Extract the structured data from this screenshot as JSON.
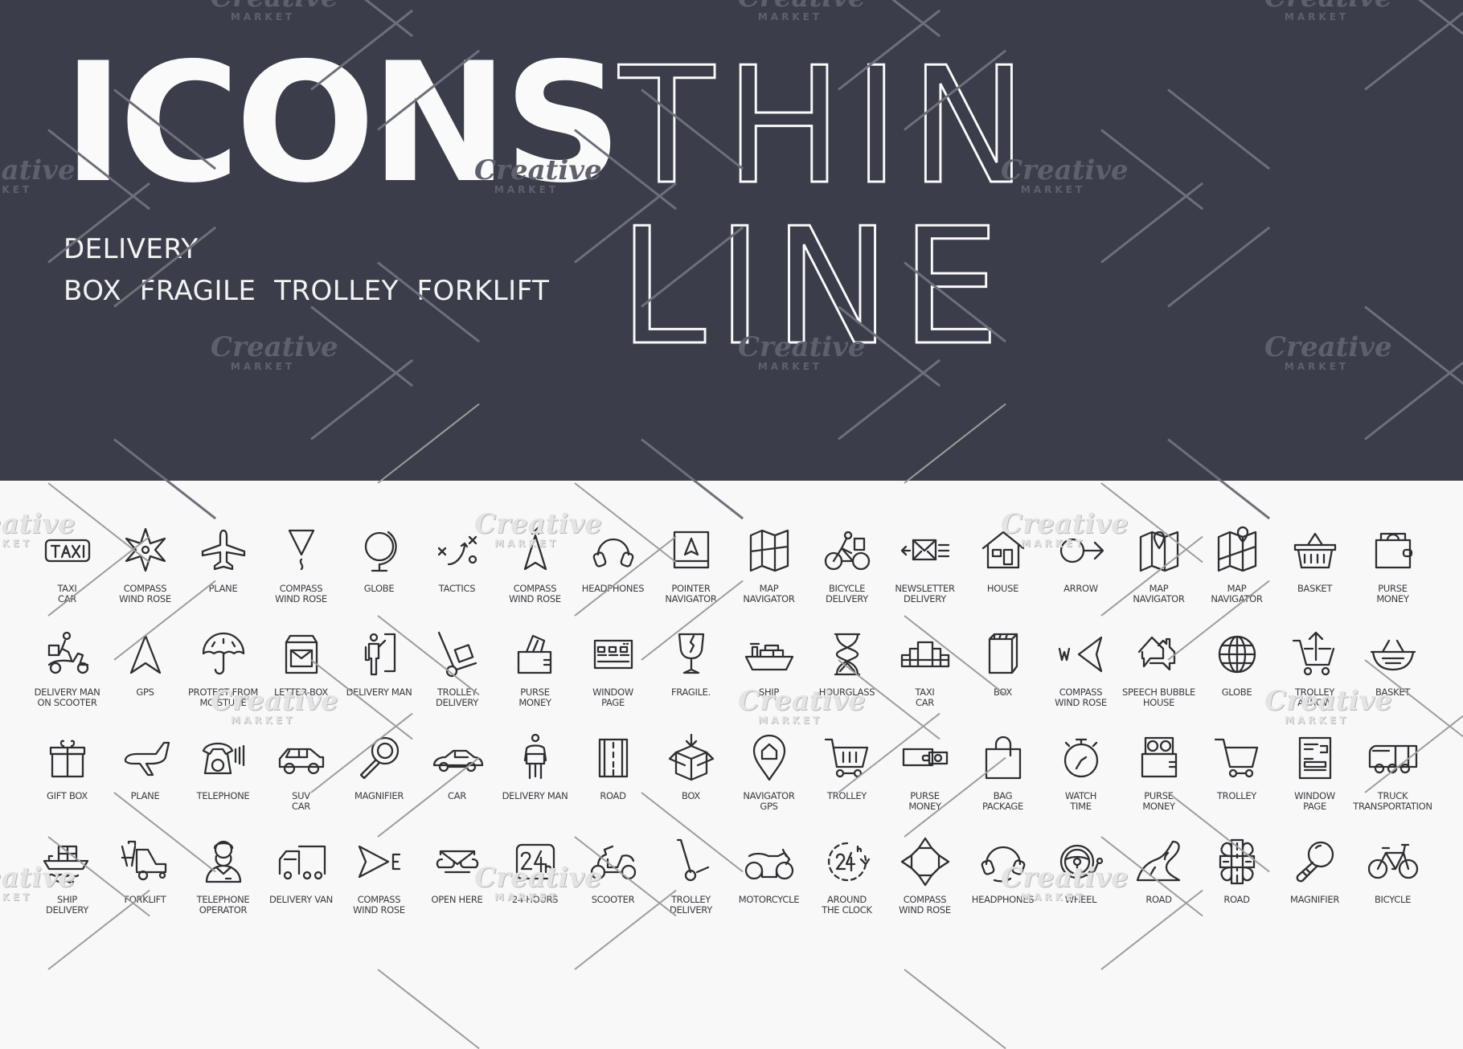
{
  "hero": {
    "title_bold": "ICONS",
    "title_thin": "THIN LINE",
    "category": "DELIVERY",
    "keywords": "BOX  FRAGILE  TROLLEY  FORKLIFT",
    "background_color": "#3b3e4a",
    "text_color": "#fafafa"
  },
  "watermark": {
    "line1": "Creative",
    "line2": "MARKET"
  },
  "icon_rows": [
    [
      {
        "icon": "taxi-sign-icon",
        "label": "TAXI\nCAR"
      },
      {
        "icon": "compass-star-icon",
        "label": "COMPASS\nWIND ROSE"
      },
      {
        "icon": "plane-icon",
        "label": "PLANE"
      },
      {
        "icon": "compass-south-icon",
        "label": "COMPASS\nWIND ROSE"
      },
      {
        "icon": "globe-stand-icon",
        "label": "GLOBE"
      },
      {
        "icon": "tactics-icon",
        "label": "TACTICS"
      },
      {
        "icon": "compass-north-icon",
        "label": "COMPASS\nWIND ROSE"
      },
      {
        "icon": "headphones-icon",
        "label": "HEADPHONES"
      },
      {
        "icon": "pointer-navigator-icon",
        "label": "POINTER\nNAVIGATOR"
      },
      {
        "icon": "folded-map-icon",
        "label": "MAP\nNAVIGATOR"
      },
      {
        "icon": "bicycle-delivery-icon",
        "label": "BICYCLE\nDELIVERY"
      },
      {
        "icon": "newsletter-icon",
        "label": "NEWSLETTER\nDELIVERY"
      },
      {
        "icon": "house-icon",
        "label": "HOUSE"
      },
      {
        "icon": "arrow-circle-icon",
        "label": "ARROW"
      },
      {
        "icon": "map-pin-icon",
        "label": "MAP\nNAVIGATOR"
      },
      {
        "icon": "map-pin-route-icon",
        "label": "MAP\nNAVIGATOR"
      },
      {
        "icon": "basket-icon",
        "label": "BASKET"
      },
      {
        "icon": "purse-icon",
        "label": "PURSE\nMONEY"
      }
    ],
    [
      {
        "icon": "delivery-scooter-icon",
        "label": "DELIVERY MAN\nON SCOOTER"
      },
      {
        "icon": "gps-arrow-icon",
        "label": "GPS"
      },
      {
        "icon": "umbrella-icon",
        "label": "PROTECT FROM\nMOISTURE"
      },
      {
        "icon": "letter-box-icon",
        "label": "LETTER-BOX"
      },
      {
        "icon": "delivery-man-door-icon",
        "label": "DELIVERY MAN"
      },
      {
        "icon": "hand-trolley-box-icon",
        "label": "TROLLEY\nDELIVERY"
      },
      {
        "icon": "purse-money-icon",
        "label": "PURSE\nMONEY"
      },
      {
        "icon": "window-page-icon",
        "label": "WINDOW\nPAGE"
      },
      {
        "icon": "broken-glass-icon",
        "label": "FRAGILE."
      },
      {
        "icon": "cargo-ship-icon",
        "label": "SHIP"
      },
      {
        "icon": "hourglass-icon",
        "label": "HOURGLASS"
      },
      {
        "icon": "taxi-checker-icon",
        "label": "TAXI\nCAR"
      },
      {
        "icon": "box-icon",
        "label": "BOX"
      },
      {
        "icon": "compass-west-icon",
        "label": "COMPASS\nWIND ROSE"
      },
      {
        "icon": "speech-bubble-house-icon",
        "label": "SPEECH BUBBLE\nHOUSE"
      },
      {
        "icon": "globe-icon",
        "label": "GLOBE"
      },
      {
        "icon": "trolley-arrow-icon",
        "label": "TROLLEY\nARROW"
      },
      {
        "icon": "basket-round-icon",
        "label": "BASKET"
      }
    ],
    [
      {
        "icon": "gift-box-icon",
        "label": "GIFT BOX"
      },
      {
        "icon": "plane-side-icon",
        "label": "PLANE"
      },
      {
        "icon": "telephone-icon",
        "label": "TELEPHONE"
      },
      {
        "icon": "suv-car-icon",
        "label": "SUV\nCAR"
      },
      {
        "icon": "magnifier-icon",
        "label": "MAGNIFIER"
      },
      {
        "icon": "sedan-car-icon",
        "label": "CAR"
      },
      {
        "icon": "delivery-man-box-icon",
        "label": "DELIVERY MAN"
      },
      {
        "icon": "road-straight-icon",
        "label": "ROAD"
      },
      {
        "icon": "open-box-icon",
        "label": "BOX"
      },
      {
        "icon": "navigator-pin-icon",
        "label": "NAVIGATOR\nGPS"
      },
      {
        "icon": "shopping-trolley-icon",
        "label": "TROLLEY"
      },
      {
        "icon": "purse-cash-icon",
        "label": "PURSE\nMONEY"
      },
      {
        "icon": "shopping-bag-icon",
        "label": "BAG\nPACKAGE"
      },
      {
        "icon": "stopwatch-icon",
        "label": "WATCH\nTIME"
      },
      {
        "icon": "wallet-coins-icon",
        "label": "PURSE\nMONEY"
      },
      {
        "icon": "cart-icon",
        "label": "TROLLEY"
      },
      {
        "icon": "document-page-icon",
        "label": "WINDOW\nPAGE"
      },
      {
        "icon": "truck-icon",
        "label": "TRUCK\nTRANSPORTATION"
      }
    ],
    [
      {
        "icon": "ship-delivery-icon",
        "label": "SHIP\nDELIVERY"
      },
      {
        "icon": "forklift-icon",
        "label": "FORKLIFT"
      },
      {
        "icon": "telephone-operator-icon",
        "label": "TELEPHONE\nOPERATOR"
      },
      {
        "icon": "delivery-van-icon",
        "label": "DELIVERY VAN"
      },
      {
        "icon": "compass-east-icon",
        "label": "COMPASS\nWIND ROSE"
      },
      {
        "icon": "open-envelope-icon",
        "label": "OPEN HERE"
      },
      {
        "icon": "24-hours-icon",
        "label": "24 HOURS"
      },
      {
        "icon": "scooter-icon",
        "label": "SCOOTER"
      },
      {
        "icon": "hand-trolley-icon",
        "label": "TROLLEY\nDELIVERY"
      },
      {
        "icon": "motorcycle-icon",
        "label": "MOTORCYCLE"
      },
      {
        "icon": "around-clock-icon",
        "label": "AROUND\nTHE CLOCK"
      },
      {
        "icon": "compass-four-icon",
        "label": "COMPASS\nWIND ROSE"
      },
      {
        "icon": "headset-icon",
        "label": "HEADPHONES"
      },
      {
        "icon": "steering-wheel-icon",
        "label": "WHEEL"
      },
      {
        "icon": "winding-road-icon",
        "label": "ROAD"
      },
      {
        "icon": "road-junction-icon",
        "label": "ROAD"
      },
      {
        "icon": "magnifier-handle-icon",
        "label": "MAGNIFIER"
      },
      {
        "icon": "bicycle-icon",
        "label": "BICYCLE"
      }
    ]
  ]
}
